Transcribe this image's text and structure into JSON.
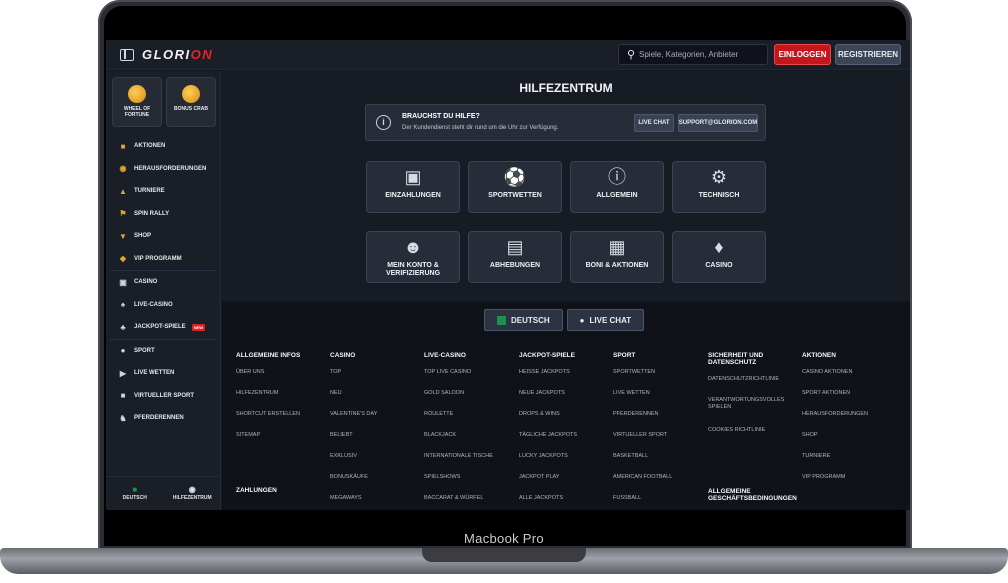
{
  "device": {
    "label": "Macbook Pro"
  },
  "header": {
    "logo": "GLORION",
    "search_placeholder": "Spiele, Kategorien, Anbieter",
    "login": "EINLOGGEN",
    "register": "REGISTRIEREN"
  },
  "sidebar": {
    "promos": [
      {
        "label": "WHEEL OF FORTUNE"
      },
      {
        "label": "BONUS CRAB"
      }
    ],
    "groups": [
      [
        {
          "label": "AKTIONEN",
          "icon": "gift-icon"
        },
        {
          "label": "HERAUSFORDERUNGEN",
          "icon": "medal-icon"
        },
        {
          "label": "TURNIERE",
          "icon": "trophy-icon"
        },
        {
          "label": "SPIN RALLY",
          "icon": "flag-icon"
        },
        {
          "label": "SHOP",
          "icon": "basket-icon"
        },
        {
          "label": "VIP PROGRAMM",
          "icon": "diamond-icon"
        }
      ],
      [
        {
          "label": "CASINO",
          "icon": "slot-icon"
        },
        {
          "label": "LIVE-CASINO",
          "icon": "cards-icon"
        },
        {
          "label": "JACKPOT-SPIELE",
          "icon": "clover-icon",
          "badge": "NEW"
        }
      ],
      [
        {
          "label": "SPORT",
          "icon": "ball-icon"
        },
        {
          "label": "LIVE WETTEN",
          "icon": "live-icon"
        },
        {
          "label": "VIRTUELLER SPORT",
          "icon": "gamepad-icon"
        },
        {
          "label": "PFERDERENNEN",
          "icon": "horse-icon"
        }
      ]
    ],
    "bottom": [
      {
        "label": "DEUTSCH"
      },
      {
        "label": "HILFEZENTRUM"
      }
    ]
  },
  "help": {
    "title": "HILFEZENTRUM",
    "banner_title": "BRAUCHST DU HILFE?",
    "banner_text": "Der Kundendienst steht dir rund um die Uhr zur Verfügung.",
    "live_chat": "LIVE CHAT",
    "email": "SUPPORT@GLORION.COM",
    "cards": [
      {
        "label": "EINZAHLUNGEN",
        "icon": "payment-icon"
      },
      {
        "label": "SPORTWETTEN",
        "icon": "soccer-ball-icon"
      },
      {
        "label": "ALLGEMEIN",
        "icon": "info-icon"
      },
      {
        "label": "TECHNISCH",
        "icon": "gear-icon"
      },
      {
        "label": "MEIN KONTO & VERIFIZIERUNG",
        "icon": "user-icon"
      },
      {
        "label": "ABHEBUNGEN",
        "icon": "wallet-icon"
      },
      {
        "label": "BONI & AKTIONEN",
        "icon": "gift-icon"
      },
      {
        "label": "CASINO",
        "icon": "cherry-icon"
      }
    ]
  },
  "footer": {
    "language": "DEUTSCH",
    "live_chat": "LIVE CHAT",
    "columns": [
      {
        "title": "ALLGEMEINE INFOS",
        "items": [
          "ÜBER UNS",
          "HILFEZENTRUM",
          "SHORTCUT ERSTELLEN",
          "SITEMAP"
        ],
        "extra_title": "ZAHLUNGEN"
      },
      {
        "title": "CASINO",
        "items": [
          "TOP",
          "NEU",
          "VALENTINE'S DAY",
          "BELIEBT",
          "EXKLUSIV",
          "BONUSKÄUFE",
          "MEGAWAYS"
        ]
      },
      {
        "title": "LIVE-CASINO",
        "items": [
          "TOP LIVE CASINO",
          "GOLD SALOON",
          "ROULETTE",
          "BLACKJACK",
          "INTERNATIONALE TISCHE",
          "SPIELSHOWS",
          "BACCARAT & WÜRFEL"
        ]
      },
      {
        "title": "JACKPOT-SPIELE",
        "items": [
          "HEISSE JACKPOTS",
          "NEUE JACKPOTS",
          "DROPS & WINS",
          "TÄGLICHE JACKPOTS",
          "LUCKY JACKPOTS",
          "JACKPOT PLAY",
          "ALLE JACKPOTS"
        ]
      },
      {
        "title": "SPORT",
        "items": [
          "SPORTWETTEN",
          "LIVE WETTEN",
          "PFERDERENNEN",
          "VIRTUELLER SPORT",
          "BASKETBALL",
          "AMERICAN FOOTBALL",
          "FUSSBALL"
        ]
      },
      {
        "title": "SICHERHEIT UND DATENSCHUTZ",
        "items": [
          "DATENSCHUTZRICHTLINIE",
          "VERANTWORTUNGSVOLLES SPIELEN",
          "COOKIES RICHTLINIE"
        ],
        "extra_title": "ALLGEMEINE GESCHÄFTSBEDINGUNGEN"
      },
      {
        "title": "AKTIONEN",
        "items": [
          "CASINO AKTIONEN",
          "SPORT AKTIONEN",
          "HERAUSFORDERUNGEN",
          "SHOP",
          "TURNIERE",
          "VIP PROGRAMM"
        ]
      }
    ]
  },
  "colors": {
    "accent_red": "#c3171c",
    "gold": "#e0a52f",
    "bg": "#141821"
  }
}
